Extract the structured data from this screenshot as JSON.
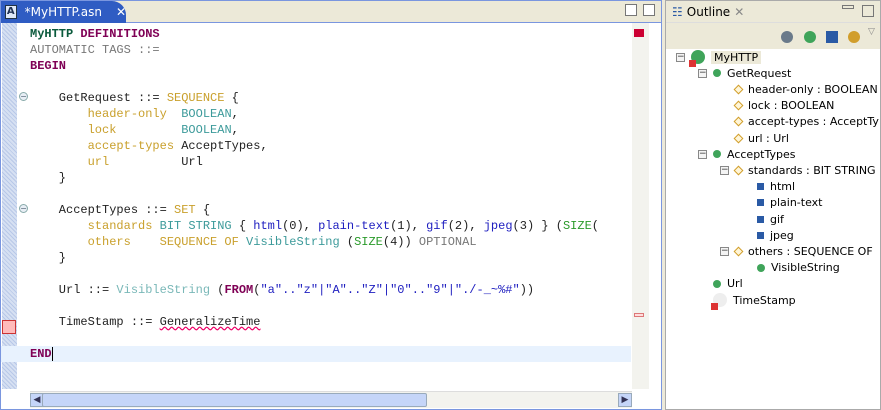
{
  "editor": {
    "tab_title": "*MyHTTP.asn",
    "tab_icon": "asn-file-icon",
    "lines": [
      [
        [
          "MyHTTP ",
          "#0a5a3c",
          1
        ],
        [
          "DEFINITIONS",
          "#7f0055",
          1
        ]
      ],
      [
        [
          "AUTOMATIC TAGS ::=",
          "#777",
          0
        ]
      ],
      [
        [
          "BEGIN",
          "#7f0055",
          1
        ]
      ],
      [],
      [
        [
          "    GetRequest ::= ",
          "#222",
          0
        ],
        [
          "SEQUENCE",
          "#c9a02c",
          0
        ],
        [
          " {",
          "#222",
          0
        ]
      ],
      [
        [
          "        header-only  ",
          "#c9a02c",
          0
        ],
        [
          "BOOLEAN",
          "#3c9a9a",
          0
        ],
        [
          ",",
          "#222",
          0
        ]
      ],
      [
        [
          "        lock         ",
          "#c9a02c",
          0
        ],
        [
          "BOOLEAN",
          "#3c9a9a",
          0
        ],
        [
          ",",
          "#222",
          0
        ]
      ],
      [
        [
          "        accept-types ",
          "#c9a02c",
          0
        ],
        [
          "AcceptTypes,",
          "#222",
          0
        ]
      ],
      [
        [
          "        url          ",
          "#c9a02c",
          0
        ],
        [
          "Url",
          "#222",
          0
        ]
      ],
      [
        [
          "    }",
          "#222",
          0
        ]
      ],
      [],
      [
        [
          "    AcceptTypes ::= ",
          "#222",
          0
        ],
        [
          "SET",
          "#c9a02c",
          0
        ],
        [
          " {",
          "#222",
          0
        ]
      ],
      [
        [
          "        standards ",
          "#c9a02c",
          0
        ],
        [
          "BIT STRING",
          "#3c9a9a",
          0
        ],
        [
          " { ",
          "#222",
          0
        ],
        [
          "html",
          "#2020c0",
          0
        ],
        [
          "(0), ",
          "#222",
          0
        ],
        [
          "plain-text",
          "#2020c0",
          0
        ],
        [
          "(1), ",
          "#222",
          0
        ],
        [
          "gif",
          "#2020c0",
          0
        ],
        [
          "(2), ",
          "#222",
          0
        ],
        [
          "jpeg",
          "#2020c0",
          0
        ],
        [
          "(3) } (",
          "#222",
          0
        ],
        [
          "SIZE",
          "#2a9a2a",
          0
        ],
        [
          "(",
          "#222",
          0
        ]
      ],
      [
        [
          "        others    ",
          "#c9a02c",
          0
        ],
        [
          "SEQUENCE OF ",
          "#c9a02c",
          0
        ],
        [
          "VisibleString",
          "#3c9a9a",
          0
        ],
        [
          " (",
          "#222",
          0
        ],
        [
          "SIZE",
          "#2a9a2a",
          0
        ],
        [
          "(4)) ",
          "#222",
          0
        ],
        [
          "OPTIONAL",
          "#777",
          0
        ]
      ],
      [
        [
          "    }",
          "#222",
          0
        ]
      ],
      [],
      [
        [
          "    Url ::= ",
          "#222",
          0
        ],
        [
          "VisibleString",
          "#7ab8b8",
          0
        ],
        [
          " (",
          "#222",
          0
        ],
        [
          "FROM",
          "#7f0055",
          1
        ],
        [
          "(",
          "#222",
          0
        ],
        [
          "\"a\"..\"z\"|\"A\"..\"Z\"|\"0\"..\"9\"|\"./-_~%#\"",
          "#2020c0",
          0
        ],
        [
          "))",
          "#222",
          0
        ]
      ],
      [],
      [
        [
          "    TimeStamp ::= ",
          "#222",
          0
        ],
        [
          "GeneralizeTime",
          "#222",
          0,
          "err"
        ]
      ],
      [],
      [
        [
          "END",
          "#7f0055",
          1
        ]
      ]
    ]
  },
  "outline": {
    "title": "Outline",
    "tree": [
      {
        "label": "MyHTTP",
        "icon": "module-icon",
        "depth": 0,
        "exp": true
      },
      {
        "label": "GetRequest",
        "icon": "type-dot-icon",
        "depth": 1,
        "exp": true
      },
      {
        "label": "header-only : BOOLEAN",
        "icon": "field-diamond-icon",
        "depth": 2
      },
      {
        "label": "lock : BOOLEAN",
        "icon": "field-diamond-icon",
        "depth": 2
      },
      {
        "label": "accept-types : AcceptTy",
        "icon": "field-diamond-icon",
        "depth": 2
      },
      {
        "label": "url : Url",
        "icon": "field-diamond-icon",
        "depth": 2
      },
      {
        "label": "AcceptTypes",
        "icon": "type-dot-icon",
        "depth": 1,
        "exp": true
      },
      {
        "label": "standards : BIT STRING",
        "icon": "field-diamond-icon",
        "depth": 2,
        "exp": true
      },
      {
        "label": "html",
        "icon": "value-square-icon",
        "depth": 3
      },
      {
        "label": "plain-text",
        "icon": "value-square-icon",
        "depth": 3
      },
      {
        "label": "gif",
        "icon": "value-square-icon",
        "depth": 3
      },
      {
        "label": "jpeg",
        "icon": "value-square-icon",
        "depth": 3
      },
      {
        "label": "others : SEQUENCE OF",
        "icon": "field-diamond-icon",
        "depth": 2,
        "exp": true
      },
      {
        "label": "VisibleString",
        "icon": "type-dot-icon",
        "depth": 3
      },
      {
        "label": "Url",
        "icon": "type-dot-icon",
        "depth": 1
      },
      {
        "label": "TimeStamp",
        "icon": "error-type-icon",
        "depth": 1
      }
    ]
  }
}
